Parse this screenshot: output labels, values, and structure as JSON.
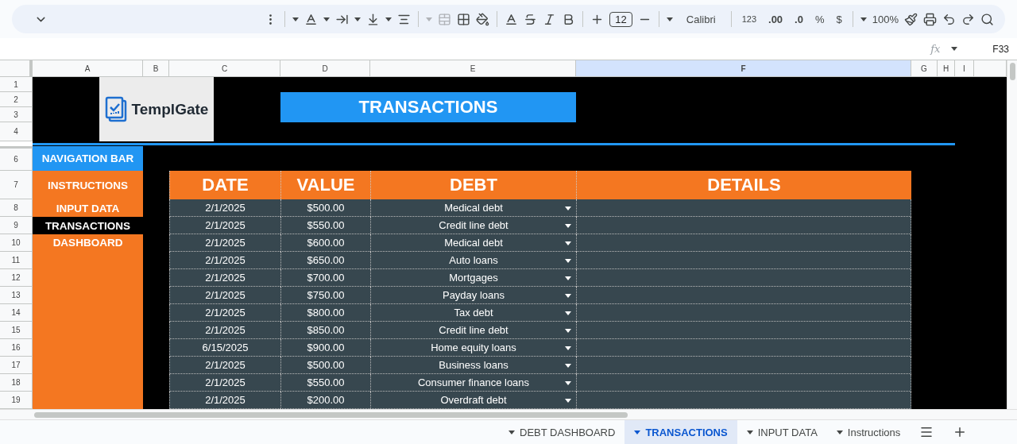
{
  "toolbar": {
    "font_size": "12",
    "font": "Calibri",
    "number_formats": [
      "123",
      ".00",
      ".0",
      "%",
      "$"
    ],
    "zoom": "100%"
  },
  "formula_bar": {
    "function_label": "fx",
    "cell_ref": "F33"
  },
  "columns": [
    {
      "label": "A",
      "selected": false
    },
    {
      "label": "B",
      "selected": false
    },
    {
      "label": "C",
      "selected": false
    },
    {
      "label": "D",
      "selected": false
    },
    {
      "label": "E",
      "selected": false
    },
    {
      "label": "F",
      "selected": true
    },
    {
      "label": "G",
      "selected": false
    },
    {
      "label": "H",
      "selected": false
    },
    {
      "label": "I",
      "selected": false
    }
  ],
  "row_numbers": [
    "1",
    "2",
    "3",
    "4",
    "6",
    "7",
    "8",
    "9",
    "10",
    "11",
    "12",
    "13",
    "14",
    "15",
    "16",
    "17",
    "18",
    "19"
  ],
  "logo": {
    "text": "TemplGate"
  },
  "title": "TRANSACTIONS",
  "navigation": {
    "heading": "NAVIGATION BAR",
    "items": [
      {
        "label": "INSTRUCTIONS",
        "selected": false
      },
      {
        "label": "INPUT DATA",
        "selected": false
      },
      {
        "label": "TRANSACTIONS",
        "selected": true
      },
      {
        "label": "DASHBOARD",
        "selected": false
      }
    ]
  },
  "table": {
    "columns": [
      "DATE",
      "VALUE",
      "DEBT",
      "DETAILS"
    ],
    "rows": [
      {
        "date": "2/1/2025",
        "value": "$500.00",
        "debt": "Medical debt"
      },
      {
        "date": "2/1/2025",
        "value": "$550.00",
        "debt": "Credit line debt"
      },
      {
        "date": "2/1/2025",
        "value": "$600.00",
        "debt": "Medical debt"
      },
      {
        "date": "2/1/2025",
        "value": "$650.00",
        "debt": "Auto loans"
      },
      {
        "date": "2/1/2025",
        "value": "$700.00",
        "debt": "Mortgages"
      },
      {
        "date": "2/1/2025",
        "value": "$750.00",
        "debt": "Payday loans"
      },
      {
        "date": "2/1/2025",
        "value": "$800.00",
        "debt": "Tax debt"
      },
      {
        "date": "2/1/2025",
        "value": "$850.00",
        "debt": "Credit line debt"
      },
      {
        "date": "6/15/2025",
        "value": "$900.00",
        "debt": "Home equity loans"
      },
      {
        "date": "2/1/2025",
        "value": "$500.00",
        "debt": "Business loans"
      },
      {
        "date": "2/1/2025",
        "value": "$550.00",
        "debt": "Consumer finance loans"
      },
      {
        "date": "2/1/2025",
        "value": "$200.00",
        "debt": "Overdraft debt"
      }
    ]
  },
  "sheet_tabs": [
    {
      "label": "DEBT DASHBOARD",
      "selected": false
    },
    {
      "label": "TRANSACTIONS",
      "selected": true
    },
    {
      "label": "INPUT DATA",
      "selected": false
    },
    {
      "label": "Instructions",
      "selected": false
    }
  ]
}
